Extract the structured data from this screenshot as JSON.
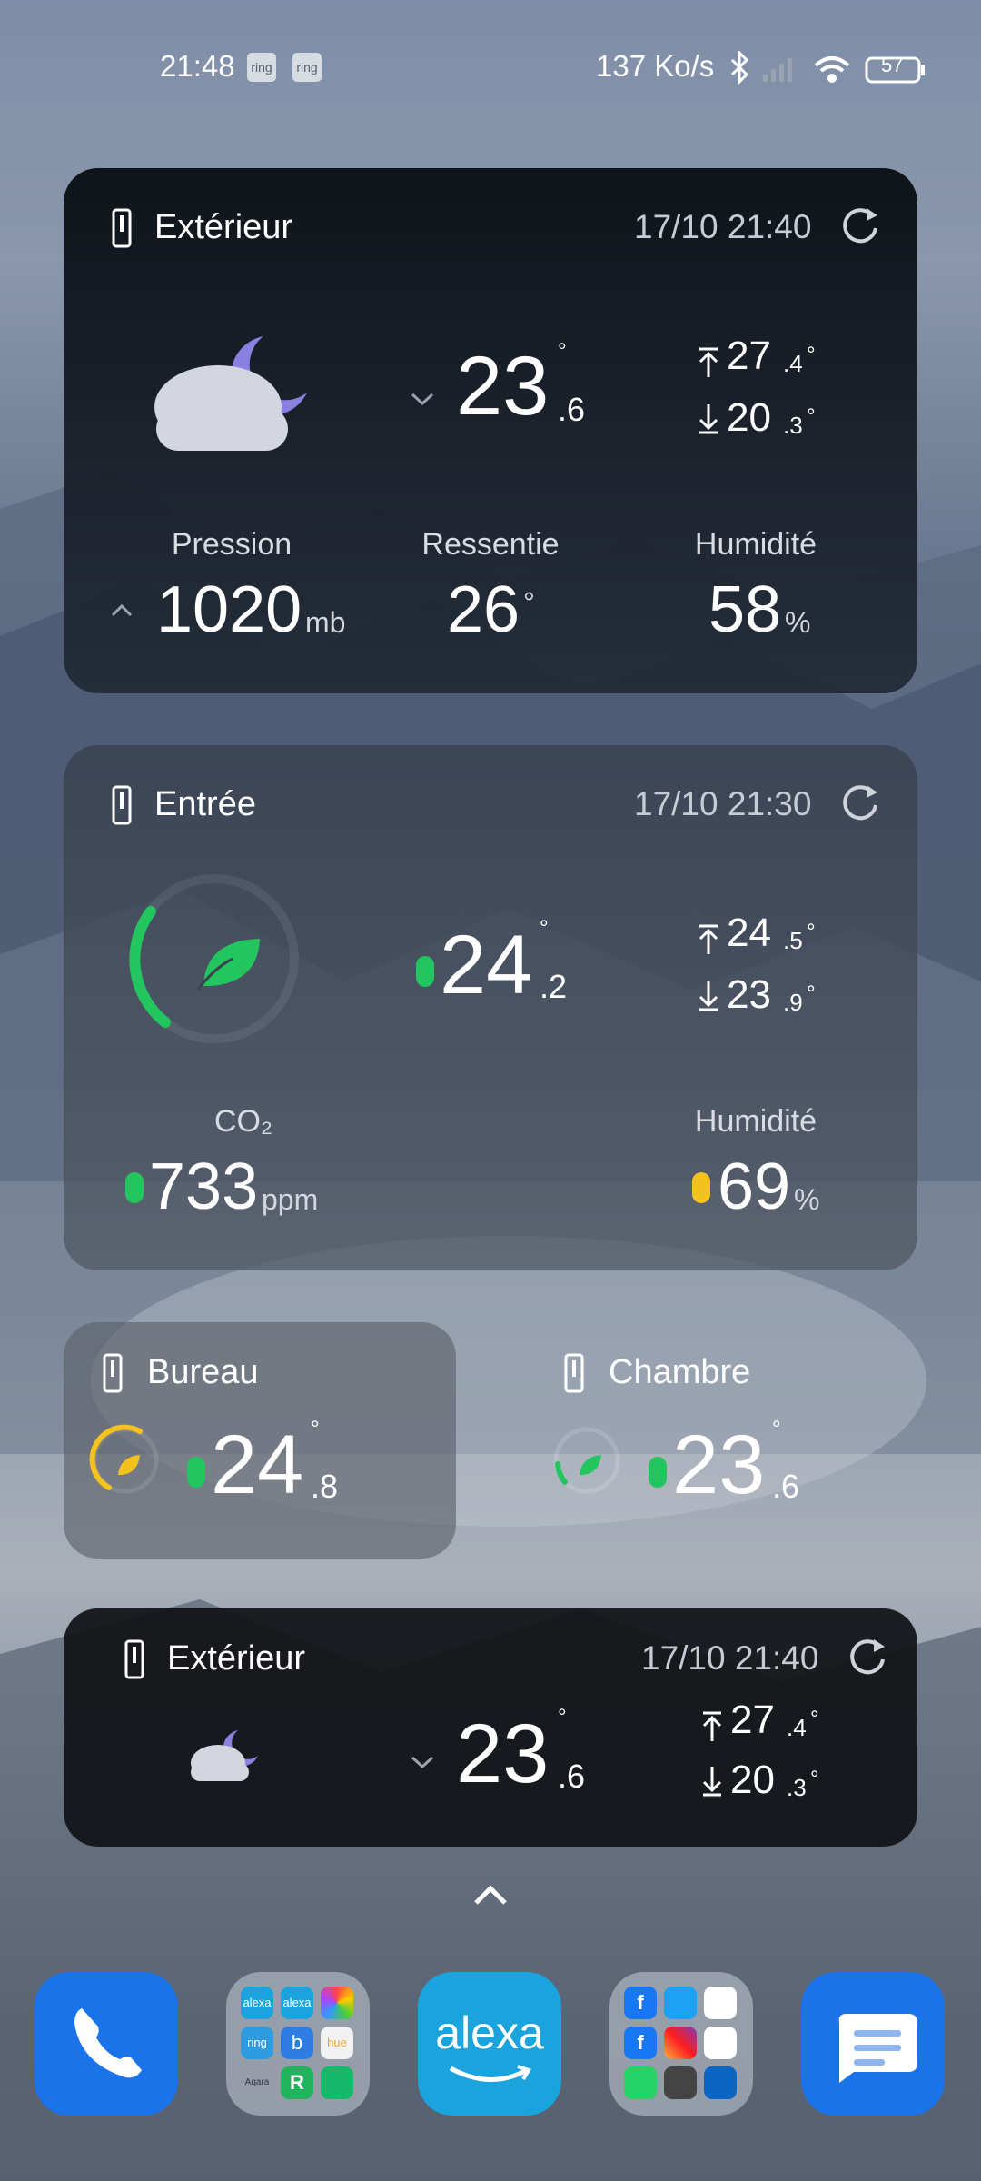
{
  "status_bar": {
    "time": "21:48",
    "badges": [
      "ring",
      "ring"
    ],
    "net_speed": "137 Ko/s",
    "battery": "57",
    "icons": [
      "bluetooth-icon",
      "signal-icon",
      "wifi-icon",
      "battery-icon"
    ]
  },
  "outdoor": {
    "title": "Extérieur",
    "timestamp": "17/10 21:40",
    "temp_int": "23",
    "temp_dec": ".6",
    "deg": "°",
    "max_int": "27",
    "max_dec": ".4",
    "min_int": "20",
    "min_dec": ".3",
    "stats": [
      {
        "label": "Pression",
        "value": "1020",
        "unit": "mb"
      },
      {
        "label": "Ressentie",
        "value": "26",
        "unit": "°"
      },
      {
        "label": "Humidité",
        "value": "58",
        "unit": "%"
      }
    ]
  },
  "entry": {
    "title": "Entrée",
    "timestamp": "17/10 21:30",
    "temp_int": "24",
    "temp_dec": ".2",
    "deg": "°",
    "max_int": "24",
    "max_dec": ".5",
    "min_int": "23",
    "min_dec": ".9",
    "co2_label": "CO₂",
    "co2_value": "733",
    "co2_unit": "ppm",
    "hum_label": "Humidité",
    "hum_value": "69",
    "hum_unit": "%"
  },
  "office": {
    "title": "Bureau",
    "temp_int": "24",
    "temp_dec": ".8",
    "deg": "°"
  },
  "bedroom": {
    "title": "Chambre",
    "temp_int": "23",
    "temp_dec": ".6",
    "deg": "°"
  },
  "outdoor_small": {
    "title": "Extérieur",
    "timestamp": "17/10 21:40",
    "temp_int": "23",
    "temp_dec": ".6",
    "deg": "°",
    "max_int": "27",
    "max_dec": ".4",
    "min_int": "20",
    "min_dec": ".3"
  },
  "dock": {
    "alexa_label": "alexa",
    "folder1": [
      "alexa",
      "alexa",
      "",
      "ring",
      "b",
      "hue",
      "Aqara",
      "R",
      ""
    ],
    "apps": [
      "phone-icon",
      "folder-smart-home",
      "alexa-app",
      "folder-social",
      "messages-icon"
    ]
  },
  "colors": {
    "co2_good": "#22c55e",
    "humidity_warn": "#f4c21f",
    "moon": "#8b7fe0",
    "dock_blue": "#1a73e8",
    "alexa_blue": "#1aa3dd"
  }
}
